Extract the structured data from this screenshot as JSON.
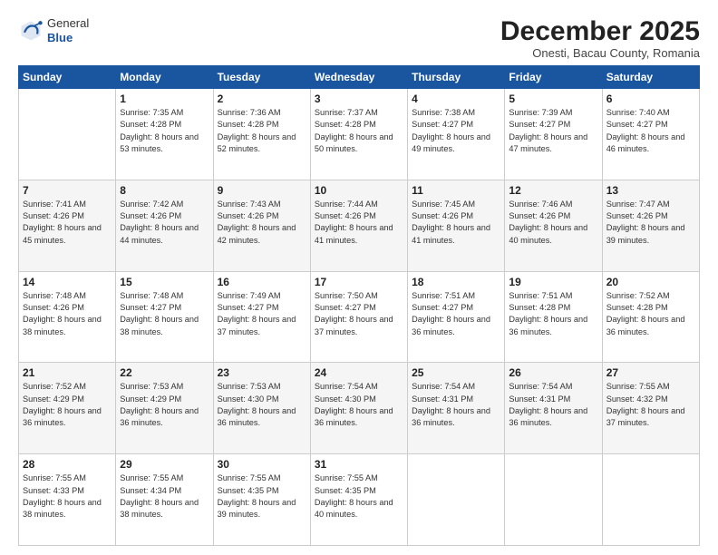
{
  "header": {
    "logo_general": "General",
    "logo_blue": "Blue",
    "month_title": "December 2025",
    "subtitle": "Onesti, Bacau County, Romania"
  },
  "days_of_week": [
    "Sunday",
    "Monday",
    "Tuesday",
    "Wednesday",
    "Thursday",
    "Friday",
    "Saturday"
  ],
  "weeks": [
    [
      {
        "day": "",
        "sunrise": "",
        "sunset": "",
        "daylight": ""
      },
      {
        "day": "1",
        "sunrise": "Sunrise: 7:35 AM",
        "sunset": "Sunset: 4:28 PM",
        "daylight": "Daylight: 8 hours and 53 minutes."
      },
      {
        "day": "2",
        "sunrise": "Sunrise: 7:36 AM",
        "sunset": "Sunset: 4:28 PM",
        "daylight": "Daylight: 8 hours and 52 minutes."
      },
      {
        "day": "3",
        "sunrise": "Sunrise: 7:37 AM",
        "sunset": "Sunset: 4:28 PM",
        "daylight": "Daylight: 8 hours and 50 minutes."
      },
      {
        "day": "4",
        "sunrise": "Sunrise: 7:38 AM",
        "sunset": "Sunset: 4:27 PM",
        "daylight": "Daylight: 8 hours and 49 minutes."
      },
      {
        "day": "5",
        "sunrise": "Sunrise: 7:39 AM",
        "sunset": "Sunset: 4:27 PM",
        "daylight": "Daylight: 8 hours and 47 minutes."
      },
      {
        "day": "6",
        "sunrise": "Sunrise: 7:40 AM",
        "sunset": "Sunset: 4:27 PM",
        "daylight": "Daylight: 8 hours and 46 minutes."
      }
    ],
    [
      {
        "day": "7",
        "sunrise": "Sunrise: 7:41 AM",
        "sunset": "Sunset: 4:26 PM",
        "daylight": "Daylight: 8 hours and 45 minutes."
      },
      {
        "day": "8",
        "sunrise": "Sunrise: 7:42 AM",
        "sunset": "Sunset: 4:26 PM",
        "daylight": "Daylight: 8 hours and 44 minutes."
      },
      {
        "day": "9",
        "sunrise": "Sunrise: 7:43 AM",
        "sunset": "Sunset: 4:26 PM",
        "daylight": "Daylight: 8 hours and 42 minutes."
      },
      {
        "day": "10",
        "sunrise": "Sunrise: 7:44 AM",
        "sunset": "Sunset: 4:26 PM",
        "daylight": "Daylight: 8 hours and 41 minutes."
      },
      {
        "day": "11",
        "sunrise": "Sunrise: 7:45 AM",
        "sunset": "Sunset: 4:26 PM",
        "daylight": "Daylight: 8 hours and 41 minutes."
      },
      {
        "day": "12",
        "sunrise": "Sunrise: 7:46 AM",
        "sunset": "Sunset: 4:26 PM",
        "daylight": "Daylight: 8 hours and 40 minutes."
      },
      {
        "day": "13",
        "sunrise": "Sunrise: 7:47 AM",
        "sunset": "Sunset: 4:26 PM",
        "daylight": "Daylight: 8 hours and 39 minutes."
      }
    ],
    [
      {
        "day": "14",
        "sunrise": "Sunrise: 7:48 AM",
        "sunset": "Sunset: 4:26 PM",
        "daylight": "Daylight: 8 hours and 38 minutes."
      },
      {
        "day": "15",
        "sunrise": "Sunrise: 7:48 AM",
        "sunset": "Sunset: 4:27 PM",
        "daylight": "Daylight: 8 hours and 38 minutes."
      },
      {
        "day": "16",
        "sunrise": "Sunrise: 7:49 AM",
        "sunset": "Sunset: 4:27 PM",
        "daylight": "Daylight: 8 hours and 37 minutes."
      },
      {
        "day": "17",
        "sunrise": "Sunrise: 7:50 AM",
        "sunset": "Sunset: 4:27 PM",
        "daylight": "Daylight: 8 hours and 37 minutes."
      },
      {
        "day": "18",
        "sunrise": "Sunrise: 7:51 AM",
        "sunset": "Sunset: 4:27 PM",
        "daylight": "Daylight: 8 hours and 36 minutes."
      },
      {
        "day": "19",
        "sunrise": "Sunrise: 7:51 AM",
        "sunset": "Sunset: 4:28 PM",
        "daylight": "Daylight: 8 hours and 36 minutes."
      },
      {
        "day": "20",
        "sunrise": "Sunrise: 7:52 AM",
        "sunset": "Sunset: 4:28 PM",
        "daylight": "Daylight: 8 hours and 36 minutes."
      }
    ],
    [
      {
        "day": "21",
        "sunrise": "Sunrise: 7:52 AM",
        "sunset": "Sunset: 4:29 PM",
        "daylight": "Daylight: 8 hours and 36 minutes."
      },
      {
        "day": "22",
        "sunrise": "Sunrise: 7:53 AM",
        "sunset": "Sunset: 4:29 PM",
        "daylight": "Daylight: 8 hours and 36 minutes."
      },
      {
        "day": "23",
        "sunrise": "Sunrise: 7:53 AM",
        "sunset": "Sunset: 4:30 PM",
        "daylight": "Daylight: 8 hours and 36 minutes."
      },
      {
        "day": "24",
        "sunrise": "Sunrise: 7:54 AM",
        "sunset": "Sunset: 4:30 PM",
        "daylight": "Daylight: 8 hours and 36 minutes."
      },
      {
        "day": "25",
        "sunrise": "Sunrise: 7:54 AM",
        "sunset": "Sunset: 4:31 PM",
        "daylight": "Daylight: 8 hours and 36 minutes."
      },
      {
        "day": "26",
        "sunrise": "Sunrise: 7:54 AM",
        "sunset": "Sunset: 4:31 PM",
        "daylight": "Daylight: 8 hours and 36 minutes."
      },
      {
        "day": "27",
        "sunrise": "Sunrise: 7:55 AM",
        "sunset": "Sunset: 4:32 PM",
        "daylight": "Daylight: 8 hours and 37 minutes."
      }
    ],
    [
      {
        "day": "28",
        "sunrise": "Sunrise: 7:55 AM",
        "sunset": "Sunset: 4:33 PM",
        "daylight": "Daylight: 8 hours and 38 minutes."
      },
      {
        "day": "29",
        "sunrise": "Sunrise: 7:55 AM",
        "sunset": "Sunset: 4:34 PM",
        "daylight": "Daylight: 8 hours and 38 minutes."
      },
      {
        "day": "30",
        "sunrise": "Sunrise: 7:55 AM",
        "sunset": "Sunset: 4:35 PM",
        "daylight": "Daylight: 8 hours and 39 minutes."
      },
      {
        "day": "31",
        "sunrise": "Sunrise: 7:55 AM",
        "sunset": "Sunset: 4:35 PM",
        "daylight": "Daylight: 8 hours and 40 minutes."
      },
      {
        "day": "",
        "sunrise": "",
        "sunset": "",
        "daylight": ""
      },
      {
        "day": "",
        "sunrise": "",
        "sunset": "",
        "daylight": ""
      },
      {
        "day": "",
        "sunrise": "",
        "sunset": "",
        "daylight": ""
      }
    ]
  ]
}
